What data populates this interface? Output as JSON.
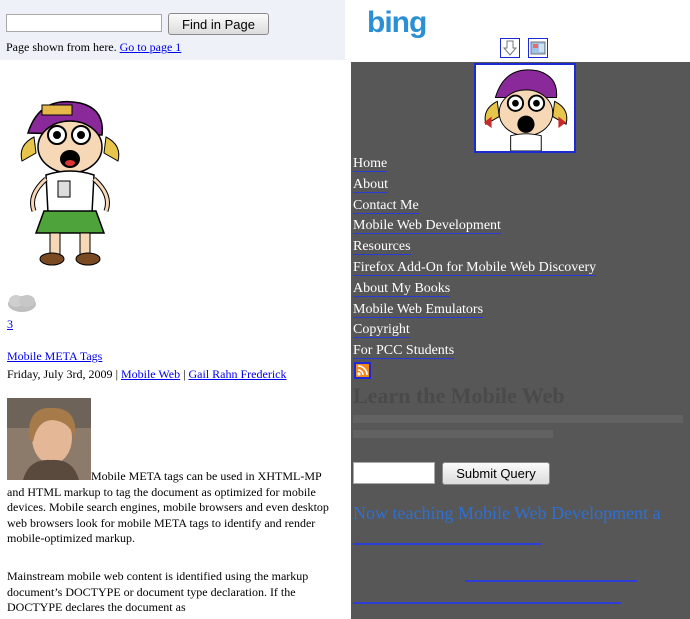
{
  "left_pane": {
    "find_button": "Find in Page",
    "find_placeholder": "",
    "shown_text": "Page shown from here.",
    "go_to_page": "Go to page 1",
    "comment_count": "3",
    "post": {
      "title": "Mobile META Tags",
      "date": "Friday, July 3rd, 2009",
      "separator": "|",
      "category": "Mobile Web",
      "author": "Gail Rahn Frederick",
      "para1": "Mobile META tags can be used in XHTML-MP and HTML markup to tag the document as optimized for mobile devices. Mobile search engines, mobile browsers and even desktop web browsers look for mobile META tags to identify and render mobile-optimized markup.",
      "para2": "Mainstream mobile web content is identified using the markup document’s DOCTYPE or document type declaration. If the DOCTYPE declares the document as"
    }
  },
  "right_pane": {
    "brand": "bing",
    "nav": [
      "Home",
      "About",
      "Contact Me",
      "Mobile Web Development",
      "Resources",
      "Firefox Add-On for Mobile Web Discovery",
      "About My Books",
      "Mobile Web Emulators",
      "Copyright",
      "For PCC Students"
    ],
    "ghost_title": "Learn the Mobile Web",
    "search_value": "",
    "submit_label": "Submit Query",
    "teaching_text": "Now teaching Mobile Web Development a"
  },
  "colors": {
    "right_bg": "#575757",
    "link": "#0000ee",
    "bing_blue": "#2b8fd6",
    "teaching_blue": "#2f6fd0"
  }
}
